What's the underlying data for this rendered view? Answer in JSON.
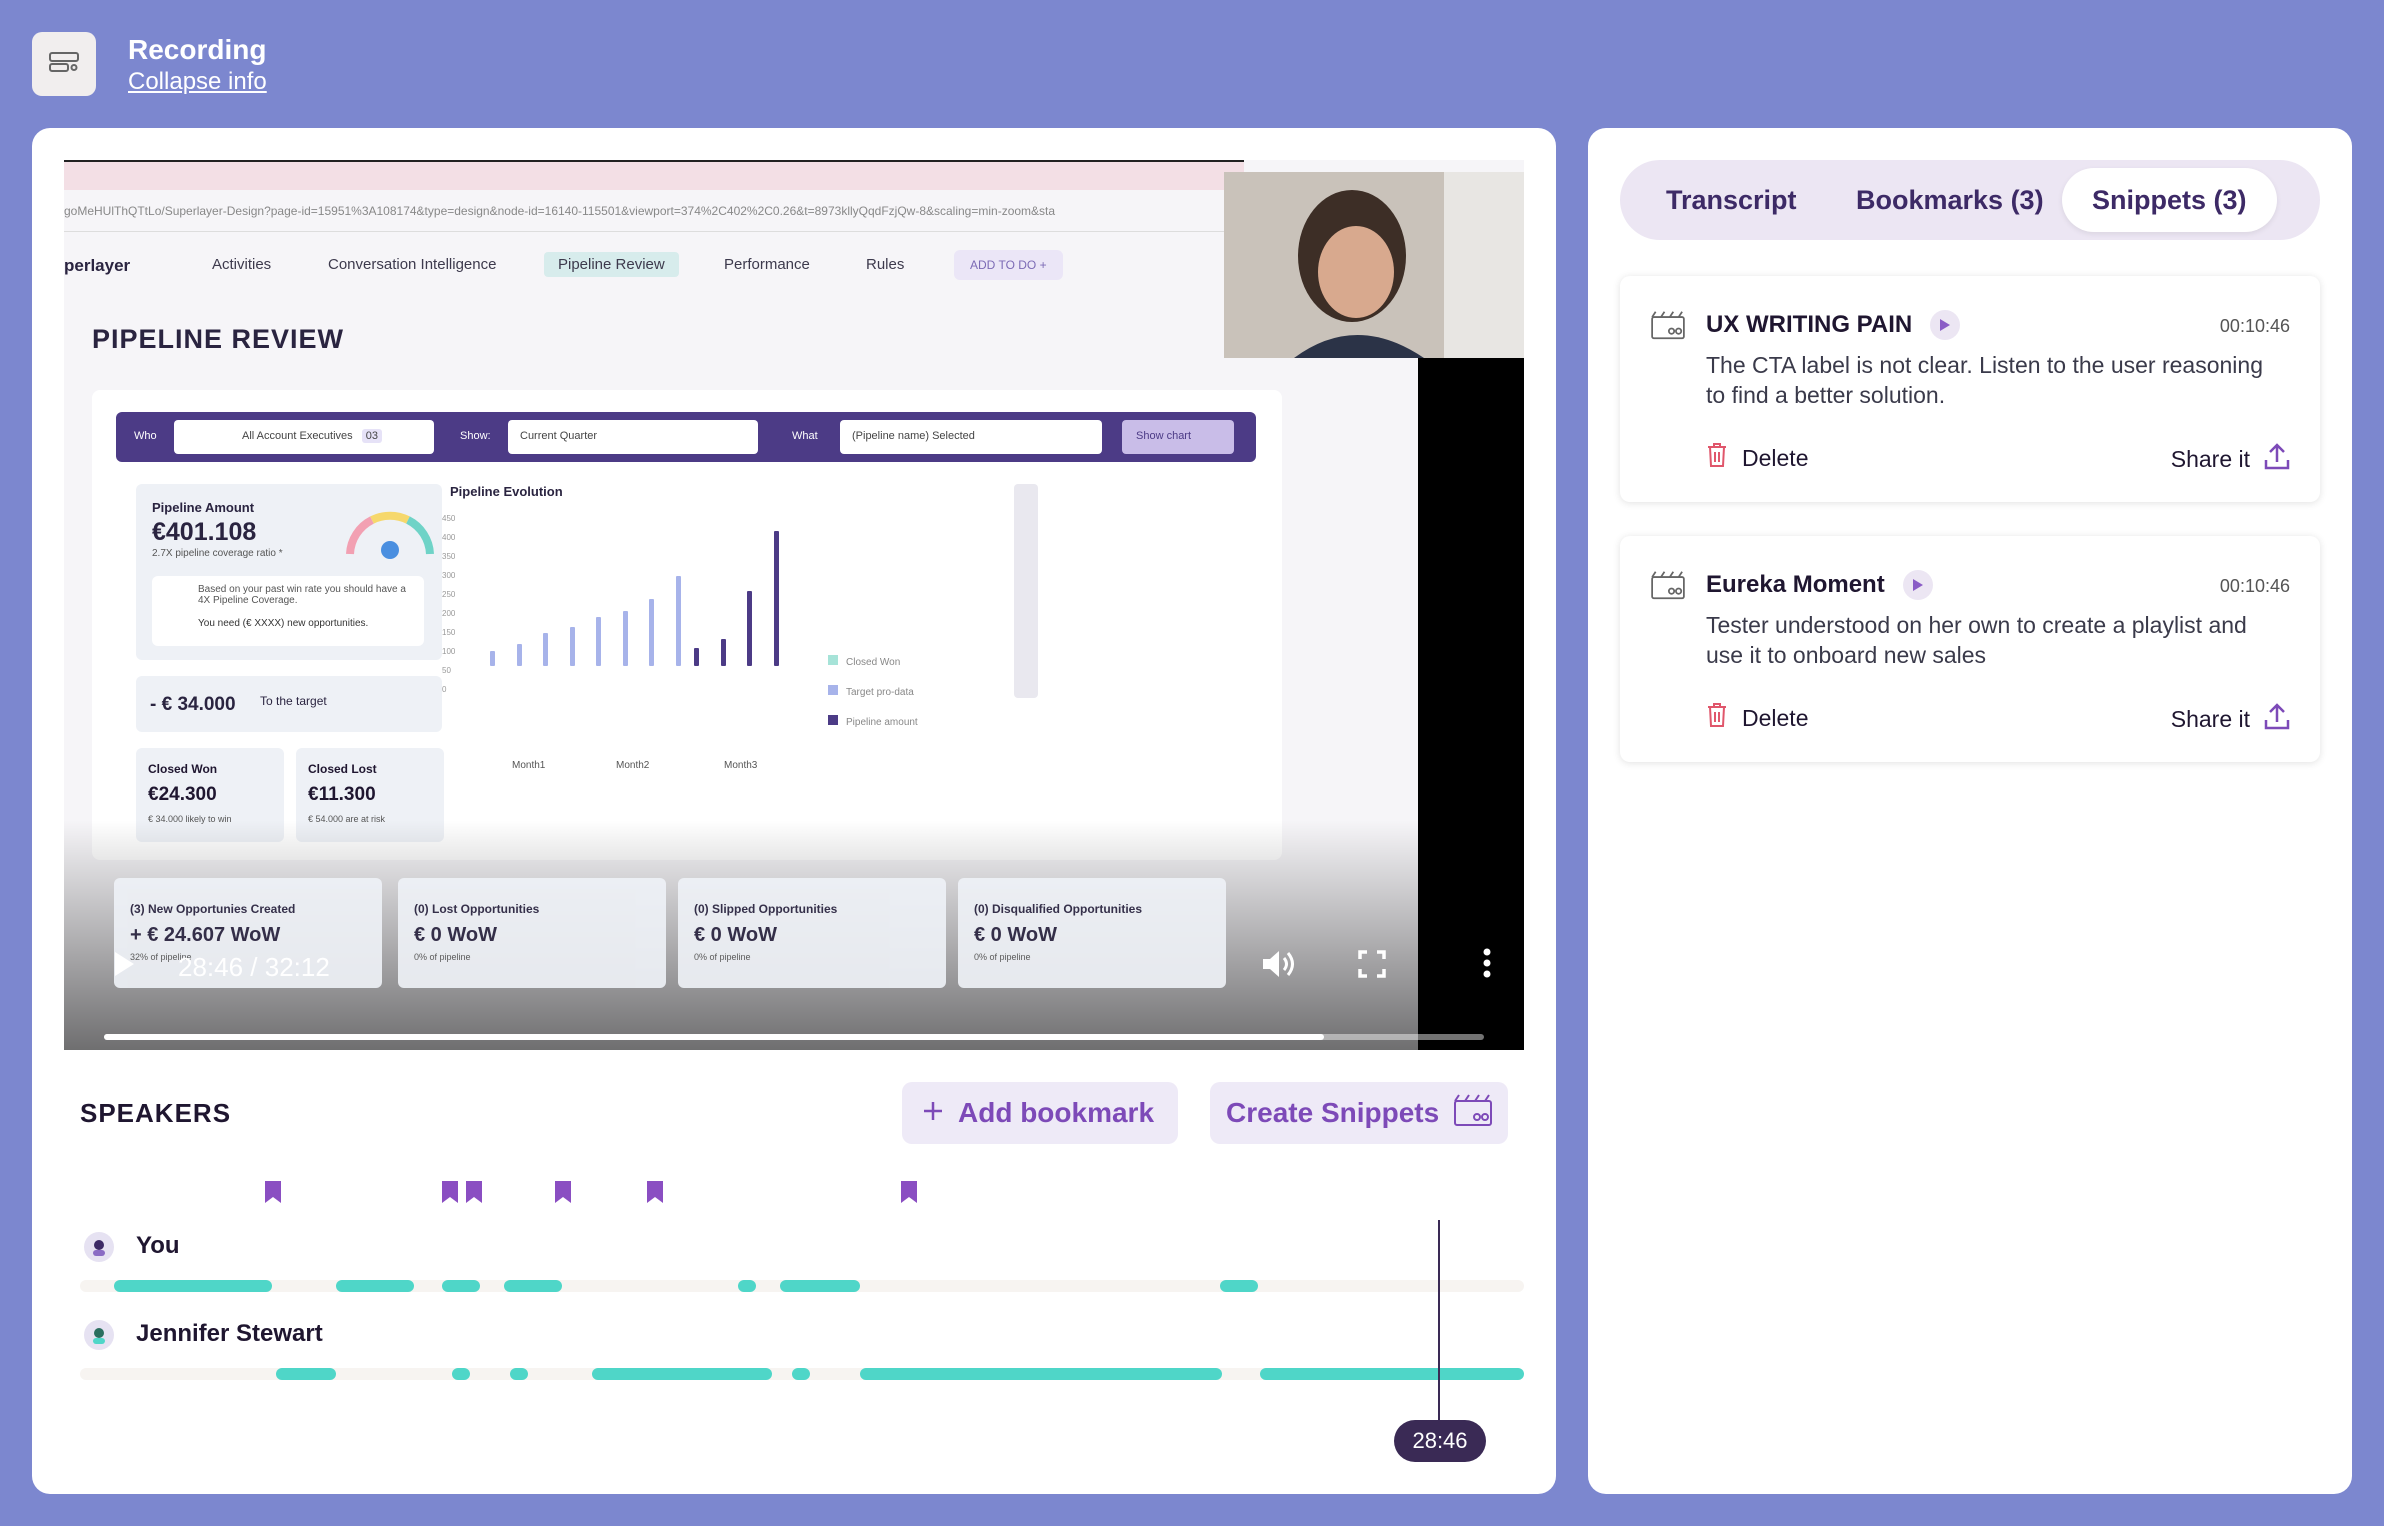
{
  "header": {
    "title": "Recording",
    "collapse_link": "Collapse info"
  },
  "video": {
    "url": "goMeHUlThQTtLo/Superlayer-Design?page-id=15951%3A108174&type=design&node-id=16140-115501&viewport=374%2C402%2C0.26&t=8973kllyQqdFzjQw-8&scaling=min-zoom&sta",
    "app_logo": "perlayer",
    "nav": [
      "Activities",
      "Conversation Intelligence",
      "Pipeline Review",
      "Performance",
      "Rules"
    ],
    "add_todo": "ADD TO DO +",
    "page_title": "PIPELINE REVIEW",
    "filters": {
      "who_label": "Who",
      "who_value": "All Account Executives",
      "who_count": "03",
      "show_label": "Show:",
      "show_value": "Current Quarter",
      "what_label": "What",
      "what_value": "(Pipeline name) Selected",
      "show_chart": "Show chart"
    },
    "pipeline_amount_label": "Pipeline Amount",
    "pipeline_amount": "€401.108",
    "coverage": "2.7X pipeline coverage ratio *",
    "advice": "Based on your past win rate you should have a 4X Pipeline Coverage.",
    "advice2": "You need (€ XXXX) new opportunities.",
    "target": "- € 34.000",
    "target_suffix": "To the target",
    "closed_won_label": "Closed Won",
    "closed_won": "€24.300",
    "closed_won_note": "€ 34.000 likely to win",
    "closed_lost_label": "Closed Lost",
    "closed_lost": "€11.300",
    "closed_lost_note": "€ 54.000 are at risk",
    "chart_title": "Pipeline Evolution",
    "chart_yticks": [
      "450",
      "400",
      "350",
      "300",
      "250",
      "200",
      "150",
      "100",
      "50",
      "0"
    ],
    "chart_months": [
      "Month1",
      "Month2",
      "Month3"
    ],
    "chart_legend": [
      "Closed Won",
      "Target pro-data",
      "Pipeline amount"
    ],
    "opportunities": [
      {
        "title": "(3) New Opportunies Created",
        "value": "+ € 24.607 WoW",
        "note": "32% of pipeline"
      },
      {
        "title": "(0) Lost Opportunities",
        "value": "€ 0 WoW",
        "note": "0% of pipeline"
      },
      {
        "title": "(0) Slipped Opportunities",
        "value": "€ 0 WoW",
        "note": "0% of pipeline"
      },
      {
        "title": "(0) Disqualified Opportunities",
        "value": "€ 0 WoW",
        "note": "0% of pipeline"
      }
    ],
    "timecode": "28:46 / 32:12",
    "progress": 0.884
  },
  "speakers": {
    "title": "SPEAKERS",
    "add_bookmark": "Add bookmark",
    "create_snippets": "Create Snippets",
    "people": [
      {
        "name": "You"
      },
      {
        "name": "Jennifer Stewart"
      }
    ],
    "playhead_time": "28:46"
  },
  "side": {
    "tabs": [
      "Transcript",
      "Bookmarks (3)",
      "Snippets (3)"
    ],
    "active_tab": "Snippets (3)",
    "snippets": [
      {
        "title": "UX WRITING PAIN",
        "time": "00:10:46",
        "description": "The CTA label is not clear. Listen to the user reasoning to find a better solution.",
        "delete": "Delete",
        "share": "Share it"
      },
      {
        "title": "Eureka Moment",
        "time": "00:10:46",
        "description": "Tester understood on her own to create a playlist and use it to onboard new sales",
        "delete": "Delete",
        "share": "Share it"
      }
    ]
  },
  "colors": {
    "accent": "#7d4ab8",
    "teal": "#4fd6c8",
    "background": "#7c87cf",
    "dark": "#3a2a55"
  }
}
